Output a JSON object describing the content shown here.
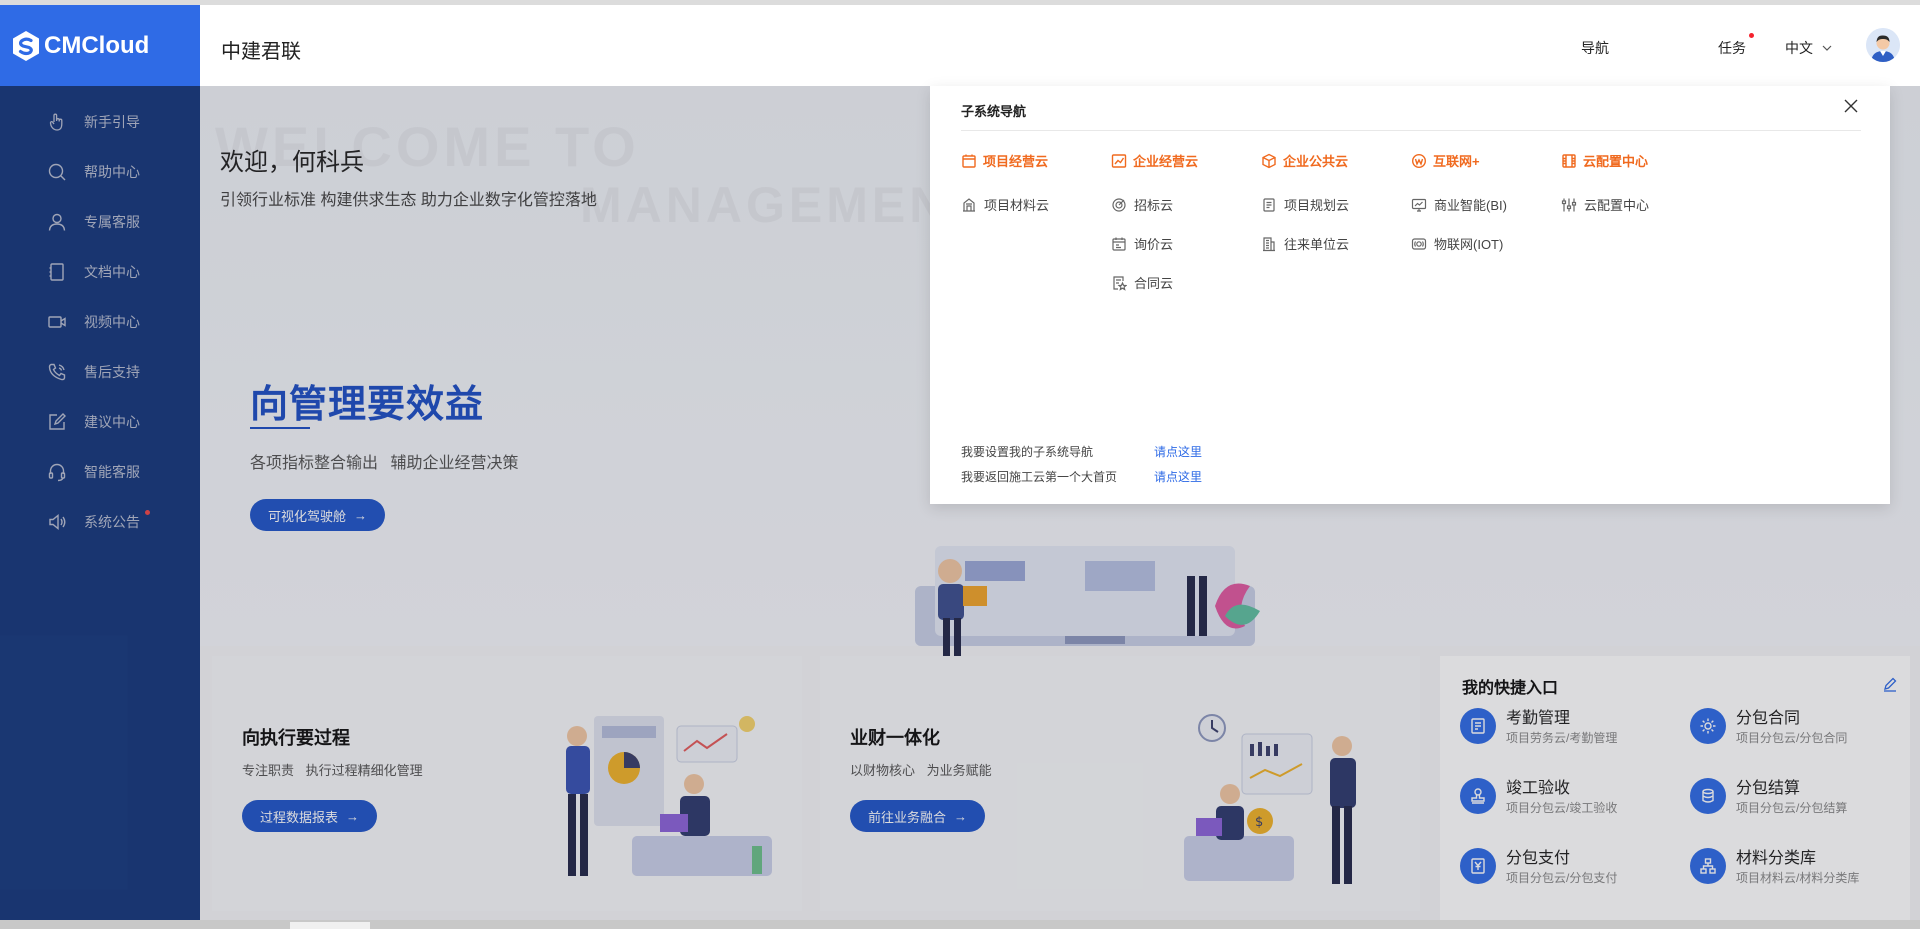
{
  "header": {
    "logo_text": "CMCloud",
    "company": "中建君联",
    "nav_label": "导航",
    "task_label": "任务",
    "lang_label": "中文"
  },
  "sidebar": {
    "items": [
      {
        "label": "新手引导",
        "icon": "hand-pointer-icon"
      },
      {
        "label": "帮助中心",
        "icon": "search-icon"
      },
      {
        "label": "专属客服",
        "icon": "user-icon"
      },
      {
        "label": "文档中心",
        "icon": "document-icon"
      },
      {
        "label": "视频中心",
        "icon": "video-icon"
      },
      {
        "label": "售后支持",
        "icon": "phone-icon"
      },
      {
        "label": "建议中心",
        "icon": "edit-icon"
      },
      {
        "label": "智能客服",
        "icon": "headset-icon"
      },
      {
        "label": "系统公告",
        "icon": "speaker-icon"
      }
    ]
  },
  "main": {
    "welcome": "欢迎，何科兵",
    "slogan": "引领行业标准 构建供求生态 助力企业数字化管控落地",
    "hero": {
      "title": "向管理要效益",
      "subtitle": "各项指标整合输出   辅助企业经营决策",
      "button": "可视化驾驶舱"
    },
    "cards": [
      {
        "title": "向执行要过程",
        "subtitle": "专注职责   执行过程精细化管理",
        "button": "过程数据报表"
      },
      {
        "title": "业财一体化",
        "subtitle": "以财物核心   为业务赋能",
        "button": "前往业务融合"
      }
    ],
    "quick": {
      "title": "我的快捷入口",
      "items": [
        {
          "name": "考勤管理",
          "path": "项目劳务云/考勤管理",
          "icon": "clipboard-icon"
        },
        {
          "name": "分包合同",
          "path": "项目分包云/分包合同",
          "icon": "gear-icon"
        },
        {
          "name": "竣工验收",
          "path": "项目分包云/竣工验收",
          "icon": "stamp-icon"
        },
        {
          "name": "分包结算",
          "path": "项目分包云/分包结算",
          "icon": "coins-icon"
        },
        {
          "name": "分包支付",
          "path": "项目分包云/分包支付",
          "icon": "payment-icon"
        },
        {
          "name": "材料分类库",
          "path": "项目材料云/材料分类库",
          "icon": "hierarchy-icon"
        }
      ]
    }
  },
  "panel": {
    "title": "子系统导航",
    "categories": [
      {
        "label": "项目经营云",
        "icon": "project-icon",
        "items": [
          {
            "label": "项目材料云",
            "icon": "building-icon"
          }
        ]
      },
      {
        "label": "企业经营云",
        "icon": "chart-icon",
        "items": [
          {
            "label": "招标云",
            "icon": "target-icon"
          },
          {
            "label": "询价云",
            "icon": "calendar-icon"
          },
          {
            "label": "合同云",
            "icon": "contract-icon"
          }
        ]
      },
      {
        "label": "企业公共云",
        "icon": "cube-icon",
        "items": [
          {
            "label": "项目规划云",
            "icon": "plan-icon"
          },
          {
            "label": "往来单位云",
            "icon": "office-icon"
          }
        ]
      },
      {
        "label": "互联网+",
        "icon": "web-icon",
        "items": [
          {
            "label": "商业智能(BI)",
            "icon": "monitor-icon"
          },
          {
            "label": "物联网(IOT)",
            "icon": "iot-icon"
          }
        ]
      },
      {
        "label": "云配置中心",
        "icon": "film-icon",
        "items": [
          {
            "label": "云配置中心",
            "icon": "sliders-icon"
          }
        ]
      }
    ],
    "footer": [
      {
        "label": "我要设置我的子系统导航",
        "link": "请点这里"
      },
      {
        "label": "我要返回施工云第一个大首页",
        "link": "请点这里"
      }
    ]
  },
  "colors": {
    "brand": "#2f6be6",
    "sidebar": "#193d86",
    "accent_orange": "#f06a1f",
    "link": "#2f6be6"
  }
}
